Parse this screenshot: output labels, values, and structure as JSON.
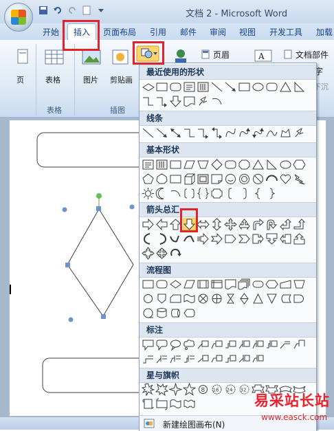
{
  "window": {
    "title": "文档 2 - Microsoft Word"
  },
  "tabs": [
    "开始",
    "插入",
    "页面布局",
    "引用",
    "邮件",
    "审阅",
    "视图",
    "开发工具",
    "加载"
  ],
  "active_tab": "插入",
  "ribbon": {
    "page_btn": "页",
    "table_btn": "表格",
    "picture_btn": "图片",
    "clipart_btn": "剪贴画",
    "header_btn": "页眉",
    "docparts_btn": "文档部件",
    "right_char": "字",
    "right_lower": "下沉",
    "group_table": "表格",
    "group_illustrations": "插图"
  },
  "gallery": {
    "recent": "最近使用的形状",
    "lines": "线条",
    "basic": "基本形状",
    "arrows": "箭头总汇",
    "flowchart": "流程图",
    "callouts": "标注",
    "stars": "星与旗帜",
    "new_canvas": "新建绘图画布(N)"
  },
  "watermark": {
    "text": "易采站长站",
    "url": "www.easck.com"
  },
  "colors": {
    "highlight": "#e0242a",
    "ribbon_text": "#15428b",
    "shape_stroke": "#3c3c3c"
  }
}
